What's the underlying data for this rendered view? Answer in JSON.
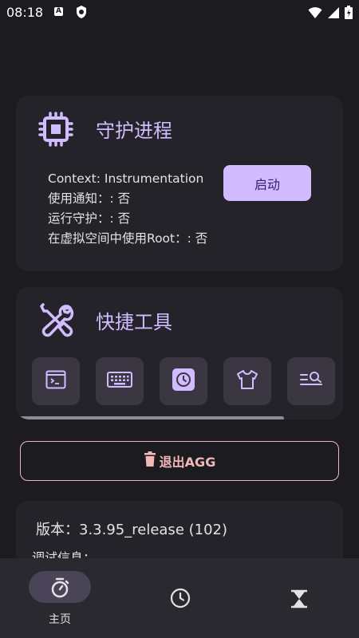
{
  "status_bar": {
    "time": "08:18",
    "notif_a": "A"
  },
  "guard_card": {
    "icon": "cpu-chip-icon",
    "title": "守护进程",
    "info": [
      "Context: Instrumentation",
      "使用通知：: 否",
      "运行守护：: 否",
      "在虚拟空间中使用Root：: 否"
    ],
    "start_label": "启动"
  },
  "tools_card": {
    "icon": "tools-icon",
    "title": "快捷工具",
    "tools": [
      "terminal-icon",
      "keyboard-icon",
      "clock-icon",
      "tshirt-icon",
      "list-search-icon"
    ]
  },
  "exit_button": {
    "icon": "trash-icon",
    "label": "退出AGG"
  },
  "version_card": {
    "version": "版本：3.3.95_release (102)",
    "debug": "调试信息："
  },
  "bottom_nav": {
    "items": [
      {
        "icon": "stopwatch-icon",
        "label": "主页",
        "selected": true
      },
      {
        "icon": "clock-icon",
        "label": ""
      },
      {
        "icon": "hourglass-icon",
        "label": ""
      }
    ]
  },
  "colors": {
    "accent": "#d0bcff",
    "danger": "#f2b8b5",
    "background": "#1c1b1f",
    "card": "#25232a"
  }
}
